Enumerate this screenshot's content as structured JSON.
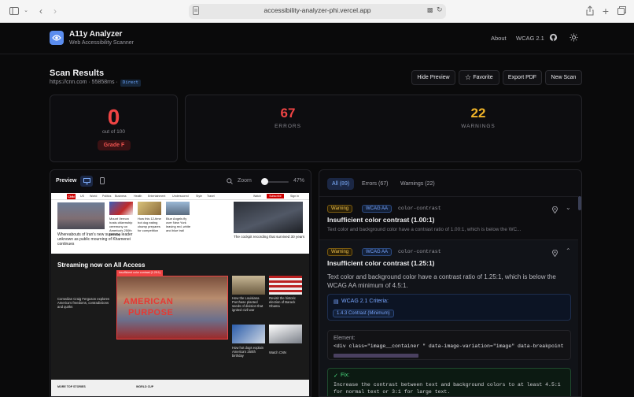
{
  "browser": {
    "url": "accessibility-analyzer-phi.vercel.app"
  },
  "app": {
    "title": "A11y Analyzer",
    "subtitle": "Web Accessibility Scanner",
    "nav": {
      "about": "About",
      "wcag": "WCAG 2.1"
    }
  },
  "scan": {
    "title": "Scan Results",
    "meta": "https://cnn.com · 55858ms ·",
    "mode_badge": "Direct",
    "buttons": {
      "hide_preview": "Hide Preview",
      "favorite": "Favorite",
      "export_pdf": "Export PDF",
      "new_scan": "New Scan"
    }
  },
  "score": {
    "value": "0",
    "out_of": "out of 100",
    "grade": "Grade F"
  },
  "stats": {
    "errors": {
      "value": "67",
      "label": "ERRORS",
      "color": "#ef4444"
    },
    "warnings": {
      "value": "22",
      "label": "WARNINGS",
      "color": "#f0b429"
    }
  },
  "preview": {
    "label": "Preview",
    "zoom_label": "Zoom",
    "zoom_value": "47%",
    "zoom_fraction": 0.47,
    "site": {
      "nav_items": [
        "US",
        "World",
        "Politics",
        "Business",
        "Health",
        "Entertainment",
        "Underscored",
        "Style",
        "Travel",
        "Watch",
        "Subscribe",
        "Sign in"
      ],
      "headline_main": "Whereabouts of Iran's new supreme leader unknown as public mourning of Khamenei continues",
      "top_stories": [
        "Mount Vernon hosts citizenship ceremony on America's 250th birthday",
        "How this 12-time hot dog eating champ prepares for competition",
        "Blue Angels fly over New York leaving red, white and blue trail"
      ],
      "video_caption": "The cockpit recording that survived 30 years",
      "streaming_title": "Streaming now on All Access",
      "highlight_tag": "Insufficient color contrast (1.25:1)",
      "feature_caption": "Comedian Craig Ferguson explores America's freedoms, contradictions and quirks",
      "feature_image_text": [
        "AMERICAN",
        "PURPOSE"
      ],
      "side_items": [
        "How the Louisiana Purchase planted seeds of division that ignited civil war",
        "Revisit the historic election of Barack Obama",
        "How hot dogs explain America's 250th birthday",
        "Watch CNN"
      ],
      "sections": [
        "MORE TOP STORIES",
        "WORLD CUP"
      ]
    }
  },
  "results": {
    "tabs": [
      {
        "label": "All (89)",
        "active": true
      },
      {
        "label": "Errors (67)",
        "active": false
      },
      {
        "label": "Warnings (22)",
        "active": false
      }
    ],
    "issues": [
      {
        "severity": "Warning",
        "level": "WCAG AA",
        "rule": "color-contrast",
        "title": "Insufficient color contrast (1.00:1)",
        "summary": "Text color and background color have a contrast ratio of 1.00:1, which is below the WC..."
      },
      {
        "severity": "Warning",
        "level": "WCAG AA",
        "rule": "color-contrast",
        "title": "Insufficient color contrast (1.25:1)",
        "description": "Text color and background color have a contrast ratio of 1.25:1, which is below the WCAG AA minimum of 4.5:1.",
        "criteria_label": "WCAG 2.1 Criteria:",
        "criteria_item": "1.4.3 Contrast (Minimum)",
        "element_label": "Element:",
        "element_code": "<div class=\"image__container \" data-image-variation=\"image\" data-breakpoint",
        "fix_label": "Fix:",
        "fix_text": "Increase the contrast between text and background colors to at least 4.5:1 for normal text or 3:1 for large text."
      }
    ]
  }
}
